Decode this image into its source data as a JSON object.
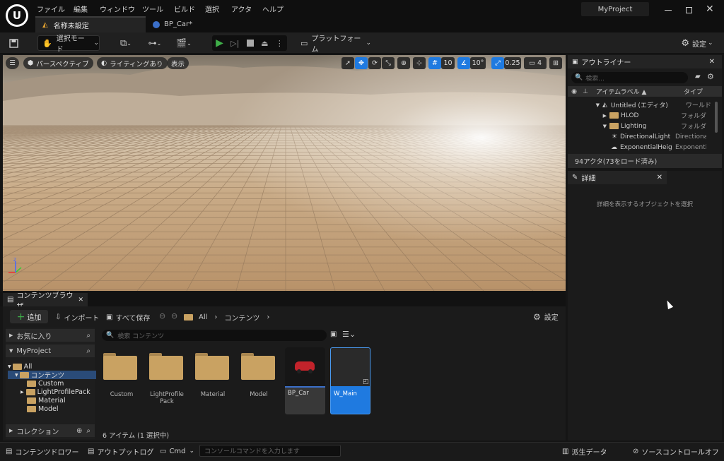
{
  "menu": [
    "ファイル",
    "編集",
    "ウィンドウ",
    "ツール",
    "ビルド",
    "選択",
    "アクタ",
    "ヘルプ"
  ],
  "project_name": "MyProject",
  "tabs": [
    {
      "label": "名称未設定",
      "active": true
    },
    {
      "label": "BP_Car*",
      "active": false
    }
  ],
  "toolbar": {
    "select_mode": "選択モード",
    "platform": "プラットフォーム",
    "settings": "設定"
  },
  "viewport": {
    "perspective": "パースペクティブ",
    "lighting": "ライティングあり",
    "show": "表示",
    "grid_size": "10",
    "angle": "10°",
    "scale": "0.25",
    "camera_speed": "4"
  },
  "outliner": {
    "tab": "アウトライナー",
    "search_placeholder": "検索...",
    "col_label": "アイテムラベル ▲",
    "col_type": "タイプ",
    "rows": [
      {
        "name": "Untitled (エディタ)",
        "type": "ワールド"
      },
      {
        "name": "HLOD",
        "type": "フォルダ"
      },
      {
        "name": "Lighting",
        "type": "フォルダ"
      },
      {
        "name": "DirectionalLight",
        "type": "Directiona"
      },
      {
        "name": "ExponentialHeig",
        "type": "Exponenti"
      }
    ],
    "status": "94アクタ(73をロード済み)"
  },
  "details": {
    "tab": "詳細",
    "empty_text": "詳細を表示するオブジェクトを選択"
  },
  "content_browser": {
    "tab": "コンテンツブラウザ",
    "add": "追加",
    "import": "インポート",
    "save_all": "すべて保存",
    "path": [
      "All",
      "コンテンツ"
    ],
    "settings": "設定",
    "favorites": "お気に入り",
    "project": "MyProject",
    "search_placeholder": "検索 コンテンツ",
    "tree": [
      "All",
      "コンテンツ",
      "Custom",
      "LightProfilePack",
      "Material",
      "Model"
    ],
    "collections": "コレクション",
    "assets": [
      {
        "name": "Custom"
      },
      {
        "name": "LightProfile Pack"
      },
      {
        "name": "Material"
      },
      {
        "name": "Model"
      },
      {
        "name": "BP_Car"
      },
      {
        "name": "W_Main"
      }
    ],
    "count": "6 アイテム (1 選択中)"
  },
  "statusbar": {
    "content_drawer": "コンテンツドロワー",
    "output_log": "アウトプットログ",
    "cmd": "Cmd",
    "console_placeholder": "コンソールコマンドを入力します",
    "derived_data": "派生データ",
    "source_control": "ソースコントロールオフ"
  },
  "colors": {
    "accent": "#1f7ae0",
    "play": "#3fae49",
    "folder": "#c9a262"
  }
}
